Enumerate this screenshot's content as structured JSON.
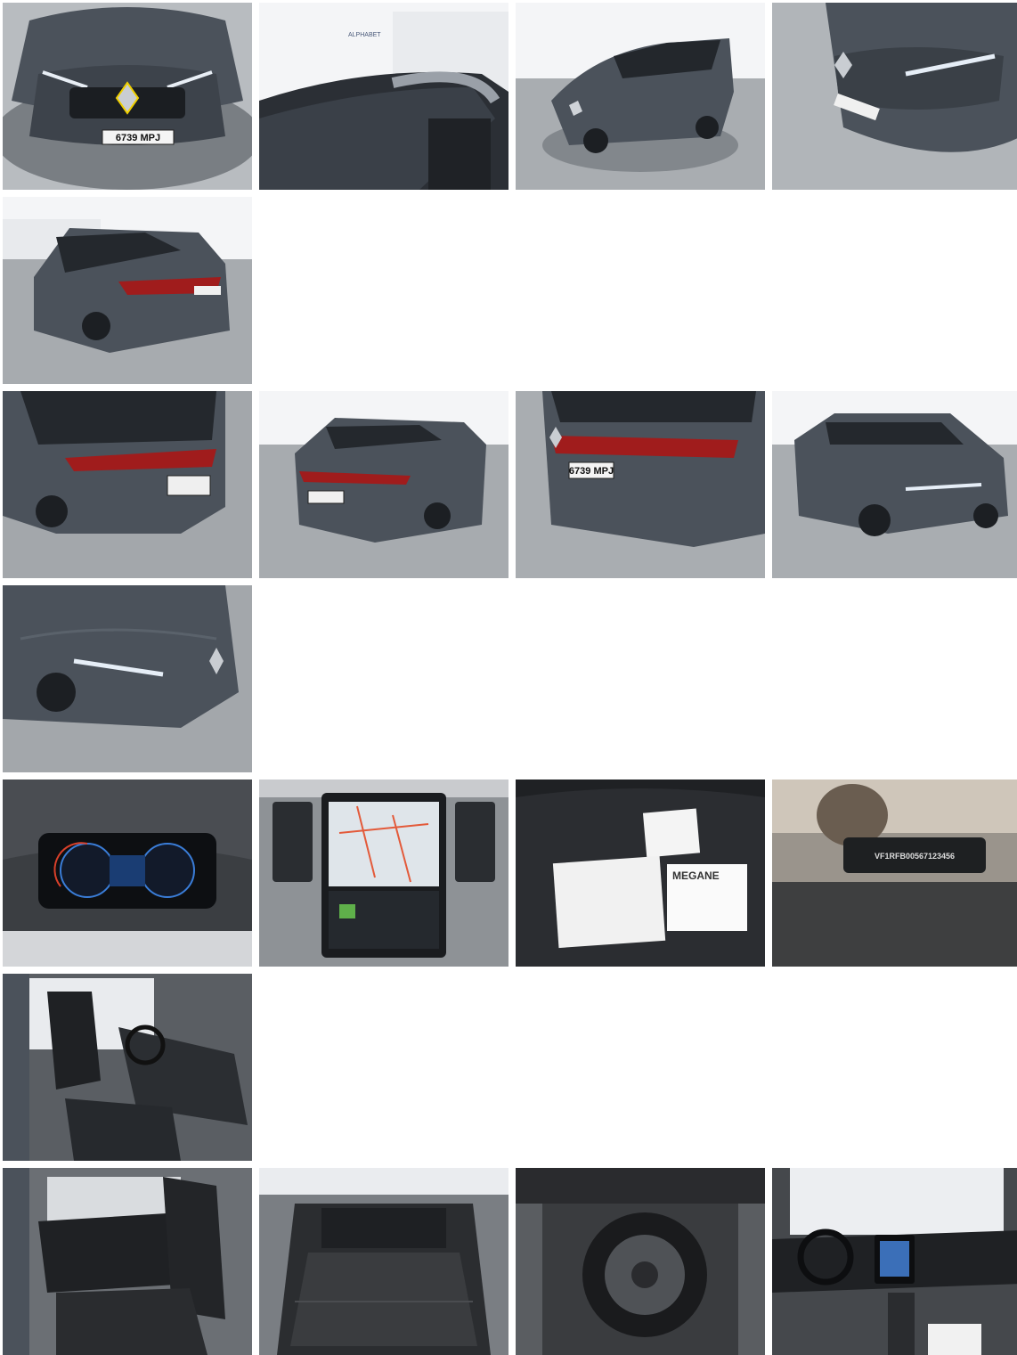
{
  "photos": [
    {
      "id": "p1",
      "plate": "6739 MPJ"
    },
    {
      "id": "p2",
      "wall_logo": "ALPHABET"
    },
    {
      "id": "p3"
    },
    {
      "id": "p4"
    },
    {
      "id": "p5"
    },
    {
      "id": "p6"
    },
    {
      "id": "p7"
    },
    {
      "id": "p8",
      "plate": "6739 MPJ"
    },
    {
      "id": "p9"
    },
    {
      "id": "p10"
    },
    {
      "id": "p11"
    },
    {
      "id": "p12"
    },
    {
      "id": "p13",
      "doc_label": "MEGANE"
    },
    {
      "id": "p14",
      "vin_tag": "VF1RFB00567123456"
    },
    {
      "id": "p15"
    },
    {
      "id": "p16"
    },
    {
      "id": "p17"
    },
    {
      "id": "p18"
    },
    {
      "id": "p19"
    }
  ],
  "colors": {
    "car_body": "#4b525b",
    "car_dark": "#2e333a",
    "asphalt": "#a5a9ad",
    "wall": "#f4f5f7",
    "taillight": "#a01c1c",
    "interior": "#1f2124"
  }
}
